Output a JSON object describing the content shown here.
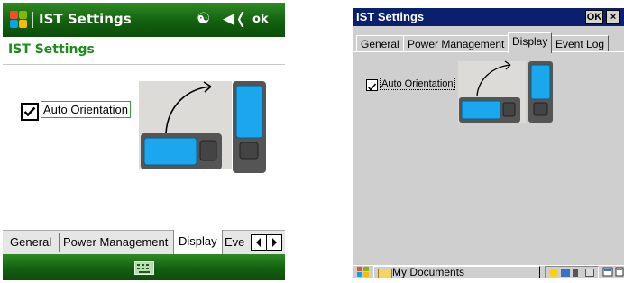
{
  "wm": {
    "title": "IST Settings",
    "ok_label": "ok",
    "header": "IST Settings",
    "auto_orientation_label": "Auto Orientation",
    "auto_orientation_checked": true,
    "tabs": [
      {
        "label": "General"
      },
      {
        "label": "Power Management"
      },
      {
        "label": "Display"
      },
      {
        "label": "Eve"
      }
    ],
    "active_tab": "Display",
    "colors": {
      "bar_green": "#136010",
      "header_text": "#1c8c1c",
      "screen_blue": "#1aa7ee"
    }
  },
  "ce": {
    "title": "IST Settings",
    "ok_label": "OK",
    "close_label": "×",
    "tabs": [
      {
        "label": "General"
      },
      {
        "label": "Power Management"
      },
      {
        "label": "Display"
      },
      {
        "label": "Event Log"
      }
    ],
    "active_tab": "Display",
    "auto_orientation_label": "Auto Orientation",
    "auto_orientation_checked": true,
    "taskbar_item": "My Documents",
    "colors": {
      "title_bar": "#0a1f6e",
      "window_bg": "#cfcfcf"
    }
  }
}
